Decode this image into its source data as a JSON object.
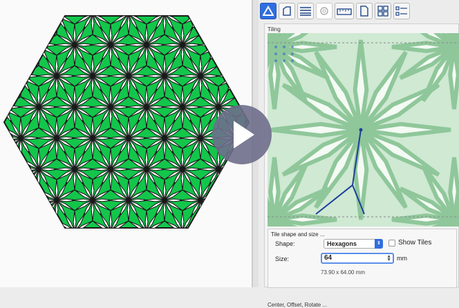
{
  "colors": {
    "accent": "#2f6ee0",
    "pattern_fill": "#13c64b",
    "pattern_stroke": "#1a1a1a",
    "preview_bg": "#cfe9d3",
    "overlay": "#6e6e8c"
  },
  "toolbar": {
    "tabs": [
      {
        "name": "tab-shape",
        "icon": "triangle-icon",
        "active": true
      },
      {
        "name": "tab-page",
        "icon": "page-corner-icon"
      },
      {
        "name": "tab-lines",
        "icon": "lines-icon"
      },
      {
        "name": "tab-lens",
        "icon": "lens-icon"
      },
      {
        "name": "tab-ruler",
        "icon": "ruler-icon"
      },
      {
        "name": "tab-document",
        "icon": "document-icon"
      },
      {
        "name": "tab-grid",
        "icon": "grid-icon"
      },
      {
        "name": "tab-list",
        "icon": "list-icon"
      }
    ]
  },
  "panel": {
    "section_title": "Tiling",
    "tile_shape_title": "Tile shape and size ...",
    "shape_label": "Shape:",
    "shape_value": "Hexagons",
    "show_tiles_label": "Show Tiles",
    "show_tiles_checked": false,
    "size_label": "Size:",
    "size_value": "64",
    "size_unit": "mm",
    "dimensions_text": "73.90 x 64.00 mm",
    "center_title": "Center, Offset, Rotate ..."
  },
  "overlay": {
    "play_icon": "play-icon"
  }
}
